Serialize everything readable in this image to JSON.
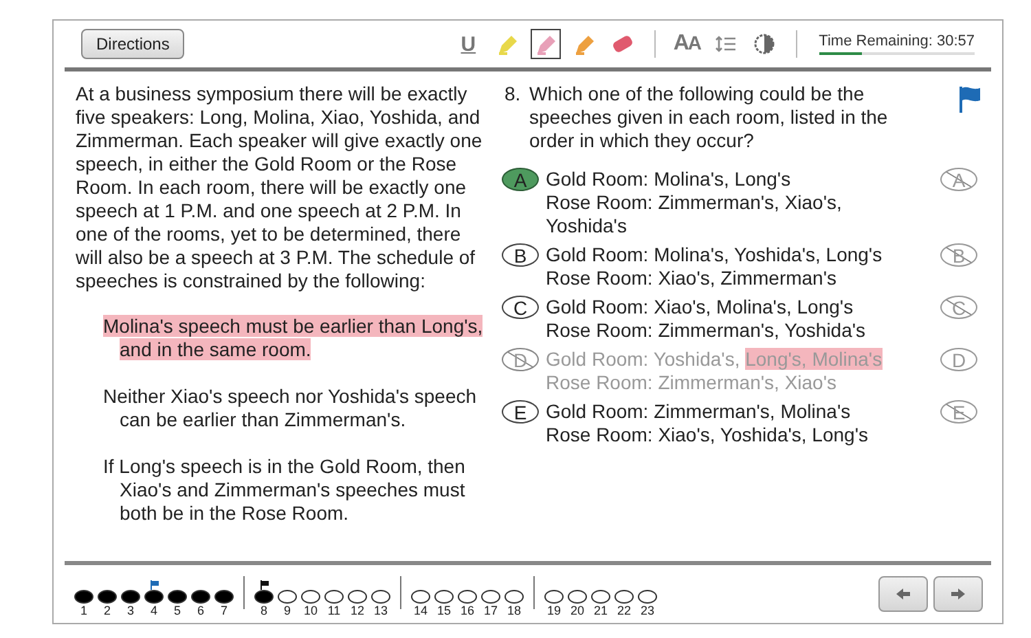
{
  "toolbar": {
    "directions": "Directions",
    "tools": [
      {
        "kind": "underline",
        "label": "U",
        "selected": false
      },
      {
        "kind": "highlighter",
        "color": "#e8d84a",
        "selected": false
      },
      {
        "kind": "highlighter",
        "color": "#e8a0b8",
        "selected": true
      },
      {
        "kind": "highlighter",
        "color": "#eda040",
        "selected": false
      },
      {
        "kind": "eraser",
        "selected": false
      },
      {
        "kind": "font",
        "label": "AA",
        "selected": false
      },
      {
        "kind": "spacing",
        "selected": false
      },
      {
        "kind": "contrast",
        "selected": false
      }
    ],
    "timer": {
      "label": "Time Remaining: 30:57",
      "level": 0.28
    }
  },
  "passage": {
    "intro": "At a business symposium there will be exactly five speakers: Long, Molina, Xiao, Yoshida, and Zimmerman. Each speaker will give exactly one speech, in either the Gold Room or the Rose Room. In each room, there will be exactly one speech at 1 P.M. and one speech at 2 P.M. In one of the rooms, yet to be determined, there will also be a speech at 3 P.M. The schedule of speeches is constrained by the following:",
    "rules": [
      {
        "segments": [
          {
            "text": "Molina's speech must be earlier than Long's, and in the same room.",
            "highlighted": true
          }
        ]
      },
      {
        "segments": [
          {
            "text": "Neither Xiao's speech nor Yoshida's speech can be earlier than Zimmerman's.",
            "highlighted": false
          }
        ]
      },
      {
        "segments": [
          {
            "text": "If Long's speech is in the Gold Room, then Xiao's and Zimmerman's speeches must both be in the Rose Room.",
            "highlighted": false
          }
        ]
      }
    ]
  },
  "question": {
    "number": "8.",
    "text": "Which one of the following could be the speeches given in each room, listed in the order in which they occur?",
    "flagged": true,
    "choices": [
      {
        "letter": "A",
        "eliminate_letter": "A",
        "selected": true,
        "eliminated": false,
        "lines": [
          [
            {
              "text": "Gold Room: Molina's, Long's",
              "highlighted": false
            }
          ],
          [
            {
              "text": "Rose Room: Zimmerman's, Xiao's,",
              "highlighted": false
            }
          ],
          [
            {
              "text": "Yoshida's",
              "highlighted": false
            }
          ]
        ]
      },
      {
        "letter": "B",
        "eliminate_letter": "B",
        "selected": false,
        "eliminated": false,
        "lines": [
          [
            {
              "text": "Gold Room: Molina's, Yoshida's, Long's",
              "highlighted": false
            }
          ],
          [
            {
              "text": "Rose Room: Xiao's, Zimmerman's",
              "highlighted": false
            }
          ]
        ]
      },
      {
        "letter": "C",
        "eliminate_letter": "C",
        "selected": false,
        "eliminated": false,
        "lines": [
          [
            {
              "text": "Gold Room: Xiao's, Molina's, Long's",
              "highlighted": false
            }
          ],
          [
            {
              "text": "Rose Room: Zimmerman's, Yoshida's",
              "highlighted": false
            }
          ]
        ]
      },
      {
        "letter": "D",
        "eliminate_letter": "D",
        "selected": false,
        "eliminated": true,
        "lines": [
          [
            {
              "text": "Gold Room: Yoshida's, ",
              "highlighted": false
            },
            {
              "text": "Long's, Molina's",
              "highlighted": true
            }
          ],
          [
            {
              "text": "Rose Room: Zimmerman's, Xiao's",
              "highlighted": false
            }
          ]
        ]
      },
      {
        "letter": "E",
        "eliminate_letter": "E",
        "selected": false,
        "eliminated": false,
        "lines": [
          [
            {
              "text": "Gold Room: Zimmerman's, Molina's",
              "highlighted": false
            }
          ],
          [
            {
              "text": "Rose Room: Xiao's, Yoshida's, Long's",
              "highlighted": false
            }
          ]
        ]
      }
    ]
  },
  "navigator": {
    "groups": [
      [
        {
          "label": "1",
          "answered": true,
          "flagged": false,
          "current": false
        },
        {
          "label": "2",
          "answered": true,
          "flagged": false,
          "current": false
        },
        {
          "label": "3",
          "answered": true,
          "flagged": false,
          "current": false
        },
        {
          "label": "4",
          "answered": true,
          "flagged": true,
          "current": false
        },
        {
          "label": "5",
          "answered": true,
          "flagged": false,
          "current": false
        },
        {
          "label": "6",
          "answered": true,
          "flagged": false,
          "current": false
        },
        {
          "label": "7",
          "answered": true,
          "flagged": false,
          "current": false
        }
      ],
      [
        {
          "label": "8",
          "answered": true,
          "flagged": false,
          "current": true
        },
        {
          "label": "9",
          "answered": false,
          "flagged": false,
          "current": false
        },
        {
          "label": "10",
          "answered": false,
          "flagged": false,
          "current": false
        },
        {
          "label": "11",
          "answered": false,
          "flagged": false,
          "current": false
        },
        {
          "label": "12",
          "answered": false,
          "flagged": false,
          "current": false
        },
        {
          "label": "13",
          "answered": false,
          "flagged": false,
          "current": false
        }
      ],
      [
        {
          "label": "14",
          "answered": false,
          "flagged": false,
          "current": false
        },
        {
          "label": "15",
          "answered": false,
          "flagged": false,
          "current": false
        },
        {
          "label": "16",
          "answered": false,
          "flagged": false,
          "current": false
        },
        {
          "label": "17",
          "answered": false,
          "flagged": false,
          "current": false
        },
        {
          "label": "18",
          "answered": false,
          "flagged": false,
          "current": false
        }
      ],
      [
        {
          "label": "19",
          "answered": false,
          "flagged": false,
          "current": false
        },
        {
          "label": "20",
          "answered": false,
          "flagged": false,
          "current": false
        },
        {
          "label": "21",
          "answered": false,
          "flagged": false,
          "current": false
        },
        {
          "label": "22",
          "answered": false,
          "flagged": false,
          "current": false
        },
        {
          "label": "23",
          "answered": false,
          "flagged": false,
          "current": false
        }
      ]
    ],
    "buttons": [
      {
        "kind": "previous"
      },
      {
        "kind": "next"
      }
    ]
  }
}
